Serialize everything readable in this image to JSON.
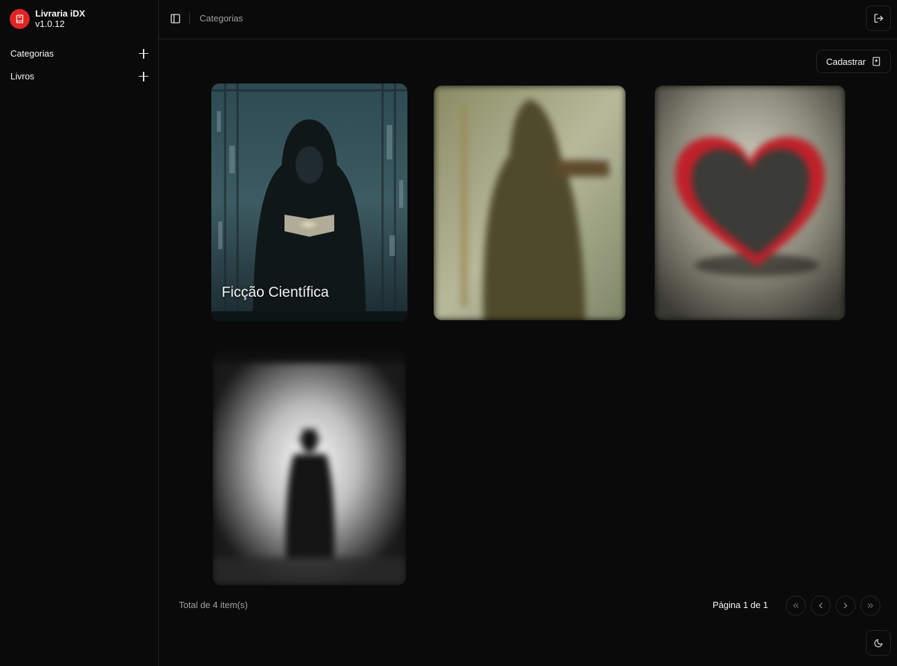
{
  "app": {
    "name": "Livraria iDX",
    "version": "v1.0.12",
    "accent": "#dc2626"
  },
  "sidebar": {
    "items": [
      {
        "label": "Categorias",
        "action_icon": "plus-icon"
      },
      {
        "label": "Livros",
        "action_icon": "plus-icon"
      }
    ]
  },
  "header": {
    "breadcrumb": "Categorias",
    "toggle_icon": "panel-left-icon",
    "logout_icon": "log-out-icon"
  },
  "main": {
    "create_label": "Cadastrar",
    "create_icon": "book-plus-icon",
    "cards": [
      {
        "title": "Ficção Científica",
        "art": "hooded figure reading a glowing book",
        "state": "hovered"
      },
      {
        "title": "",
        "art": "wizard holding a glowing book",
        "state": "blurred"
      },
      {
        "title": "",
        "art": "red heart box",
        "state": "blurred"
      },
      {
        "title": "",
        "art": "silhouette of man with hat in fog",
        "state": "blurred"
      }
    ]
  },
  "footer": {
    "total": "Total de 4 item(s)",
    "pagination": {
      "label": "Página 1 de 1",
      "buttons": [
        "first-page-icon",
        "prev-page-icon",
        "next-page-icon",
        "last-page-icon"
      ]
    }
  },
  "theme_icon": "moon-icon"
}
